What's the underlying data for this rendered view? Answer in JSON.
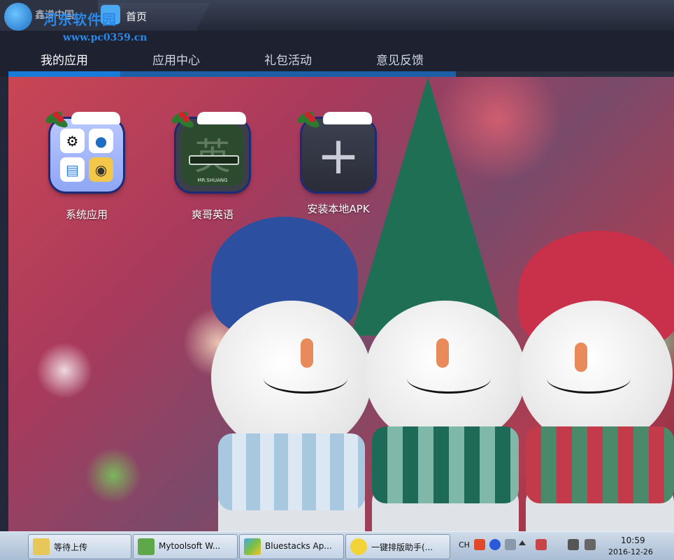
{
  "app": {
    "title_tab": "鑫谱中国",
    "home_tab": "首页",
    "watermark_logo": "河东软件园",
    "watermark_url": "www.pc0359.cn"
  },
  "nav": {
    "tabs": [
      {
        "label": "我的应用",
        "active": true
      },
      {
        "label": "应用中心",
        "active": false
      },
      {
        "label": "礼包活动",
        "active": false
      },
      {
        "label": "意见反馈",
        "active": false
      }
    ]
  },
  "apps": [
    {
      "label": "系统应用",
      "icon": "system-apps-icon"
    },
    {
      "label": "爽哥英语",
      "icon": "english-app-icon",
      "caption": "MR.SHUANG",
      "glyph": "英"
    },
    {
      "label": "安装本地APK",
      "icon": "plus-icon",
      "glyph": "+"
    }
  ],
  "taskbar": {
    "tasks": [
      {
        "label": "等待上传",
        "icon": "folder-icon"
      },
      {
        "label": "Mytoolsoft W...",
        "icon": "image-app-icon"
      },
      {
        "label": "Bluestacks Ap...",
        "icon": "bluestacks-icon"
      },
      {
        "label": "一键排版助手(...",
        "icon": "typeset-app-icon"
      }
    ],
    "tray": {
      "lang": "CH",
      "time": "10:59",
      "date": "2016-12-26"
    }
  },
  "colors": {
    "nav_active": "#1a7ad8",
    "nav_bg": "#1e2230",
    "icon_border": "#1c2b78"
  }
}
